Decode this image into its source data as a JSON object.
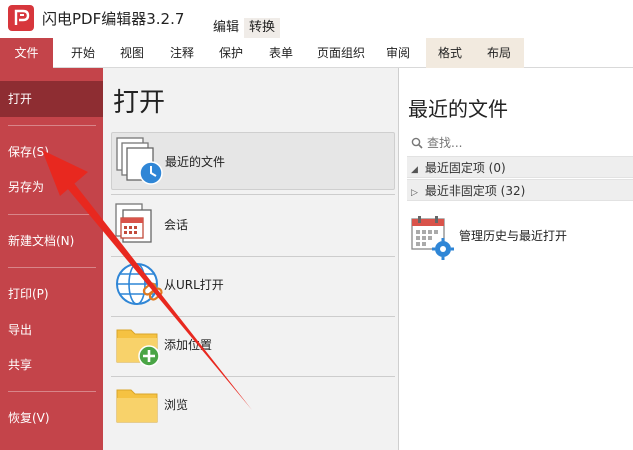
{
  "app": {
    "title": "闪电PDF编辑器3.2.7"
  },
  "context_tabs": [
    "编辑",
    "转换"
  ],
  "ribbon_tabs": [
    "文件",
    "开始",
    "视图",
    "注释",
    "保护",
    "表单",
    "页面组织",
    "审阅",
    "格式",
    "布局"
  ],
  "sidebar": {
    "items": [
      {
        "label": "打开"
      },
      {
        "label": "保存(S)"
      },
      {
        "label": "另存为"
      },
      {
        "label": "新建文档(N)"
      },
      {
        "label": "打印(P)"
      },
      {
        "label": "导出"
      },
      {
        "label": "共享"
      },
      {
        "label": "恢复(V)"
      }
    ]
  },
  "open_panel": {
    "title": "打开",
    "items": [
      {
        "label": "最近的文件",
        "icon": "recent-files-icon"
      },
      {
        "label": "会话",
        "icon": "session-icon"
      },
      {
        "label": "从URL打开",
        "icon": "globe-link-icon"
      },
      {
        "label": "添加位置",
        "icon": "folder-add-icon"
      },
      {
        "label": "浏览",
        "icon": "folder-icon"
      }
    ]
  },
  "recent_panel": {
    "title": "最近的文件",
    "search_placeholder": "查找...",
    "groups": [
      {
        "label": "最近固定项 (0)",
        "expanded": true
      },
      {
        "label": "最近非固定项 (32)",
        "expanded": false
      }
    ],
    "manage_label": "管理历史与最近打开"
  },
  "colors": {
    "sidebar_red": "#c4444a",
    "sidebar_active": "#8e2d32",
    "annotation_arrow": "#e8281f"
  }
}
